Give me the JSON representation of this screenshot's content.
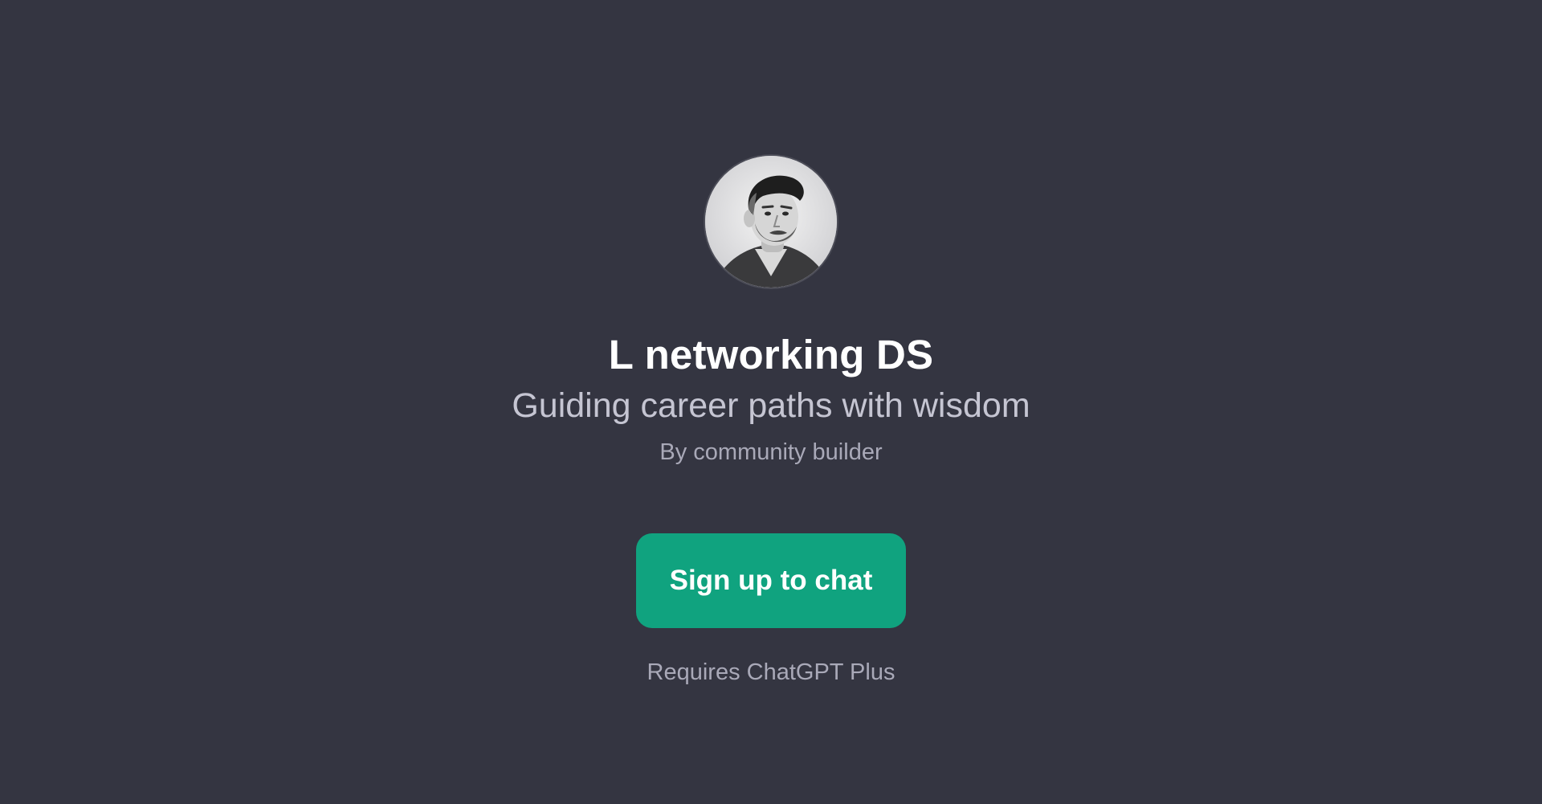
{
  "gpt": {
    "name": "L networking DS",
    "tagline": "Guiding career paths with wisdom",
    "author": "By community builder",
    "avatar_icon": "portrait-avatar"
  },
  "cta": {
    "label": "Sign up to chat"
  },
  "footer": {
    "requirement": "Requires ChatGPT Plus"
  },
  "colors": {
    "background": "#343541",
    "accent": "#10a37f",
    "title": "#ffffff",
    "subtitle": "#c5c5d2",
    "muted": "#a9a9b8"
  }
}
